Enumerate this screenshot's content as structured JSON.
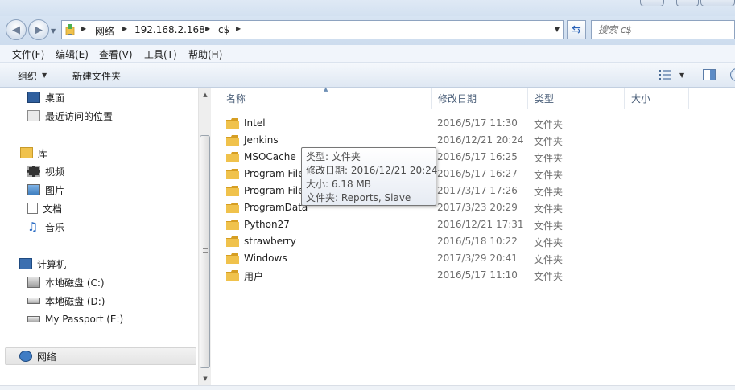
{
  "address": {
    "crumbs": [
      "网络",
      "192.168.2.168",
      "c$"
    ]
  },
  "search": {
    "placeholder": "搜索 c$"
  },
  "menu": [
    "文件(F)",
    "编辑(E)",
    "查看(V)",
    "工具(T)",
    "帮助(H)"
  ],
  "toolbar": {
    "organize_label": "组织",
    "new_folder_label": "新建文件夹"
  },
  "nav": {
    "desktop": "桌面",
    "recent": "最近访问的位置",
    "libraries": "库",
    "videos": "视频",
    "pictures": "图片",
    "documents": "文档",
    "music": "音乐",
    "computer": "计算机",
    "drive_c": "本地磁盘 (C:)",
    "drive_d": "本地磁盘 (D:)",
    "drive_e": "My Passport (E:)",
    "network": "网络"
  },
  "columns": {
    "name": "名称",
    "modified": "修改日期",
    "type": "类型",
    "size": "大小"
  },
  "files": [
    {
      "name": "Intel",
      "modified": "2016/5/17 11:30",
      "type": "文件夹"
    },
    {
      "name": "Jenkins",
      "modified": "2016/12/21 20:24",
      "type": "文件夹"
    },
    {
      "name": "MSOCache",
      "modified": "2016/5/17 16:25",
      "type": "文件夹"
    },
    {
      "name": "Program Files",
      "modified": "2016/5/17 16:27",
      "type": "文件夹"
    },
    {
      "name": "Program Files (x86)",
      "modified": "2017/3/17 17:26",
      "type": "文件夹"
    },
    {
      "name": "ProgramData",
      "modified": "2017/3/23 20:29",
      "type": "文件夹"
    },
    {
      "name": "Python27",
      "modified": "2016/12/21 17:31",
      "type": "文件夹"
    },
    {
      "name": "strawberry",
      "modified": "2016/5/18 10:22",
      "type": "文件夹"
    },
    {
      "name": "Windows",
      "modified": "2017/3/29 20:41",
      "type": "文件夹"
    },
    {
      "name": "用户",
      "modified": "2016/5/17 11:10",
      "type": "文件夹"
    }
  ],
  "tooltip": {
    "type_line": "类型: 文件夹",
    "modified_line": "修改日期: 2016/12/21 20:24",
    "size_line": "大小: 6.18 MB",
    "contents_line": "文件夹: Reports, Slave"
  },
  "colors": {
    "folder": "#f0c24c",
    "folder_dark": "#d69e22",
    "selection": "#e6e6e6"
  },
  "icons": [
    "back-arrow-icon",
    "forward-arrow-icon",
    "network-folder-icon",
    "refresh-icon",
    "search-icon",
    "views-icon",
    "preview-pane-icon",
    "help-icon",
    "folder-icon"
  ]
}
